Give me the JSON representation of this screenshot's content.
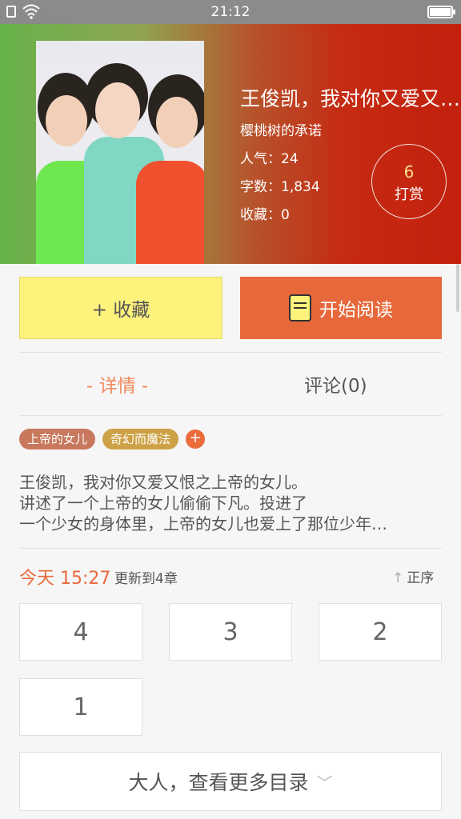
{
  "status_bar": {
    "time": "21:12"
  },
  "book": {
    "title": "王俊凯，我对你又爱又恨之上帝的女儿",
    "author": "樱桃树的承诺",
    "popularity": "人气：24",
    "word_count": "字数：1,834",
    "favorites": "收藏：0",
    "tip_count": "6",
    "tip_label": "打赏"
  },
  "actions": {
    "favorite_label": "+ 收藏",
    "read_label": "开始阅读"
  },
  "tabs": {
    "detail": "- 详情 -",
    "comments": "评论(0)"
  },
  "tags": [
    "上帝的女儿",
    "奇幻而魔法"
  ],
  "tag_add": "+",
  "description": [
    "王俊凯，我对你又爱又恨之上帝的女儿。",
    "讲述了一个上帝的女儿偷偷下凡。投进了",
    "一个少女的身体里，上帝的女儿也爱上了那位少年…"
  ],
  "update": {
    "time": "今天 15:27",
    "text": "更新到4章",
    "order_label": "正序"
  },
  "chapters": [
    "4",
    "3",
    "2",
    "1"
  ],
  "more_label": "大人，查看更多目录",
  "colors": {
    "accent": "#e7683a",
    "favorite_bg": "#fdf27c"
  }
}
